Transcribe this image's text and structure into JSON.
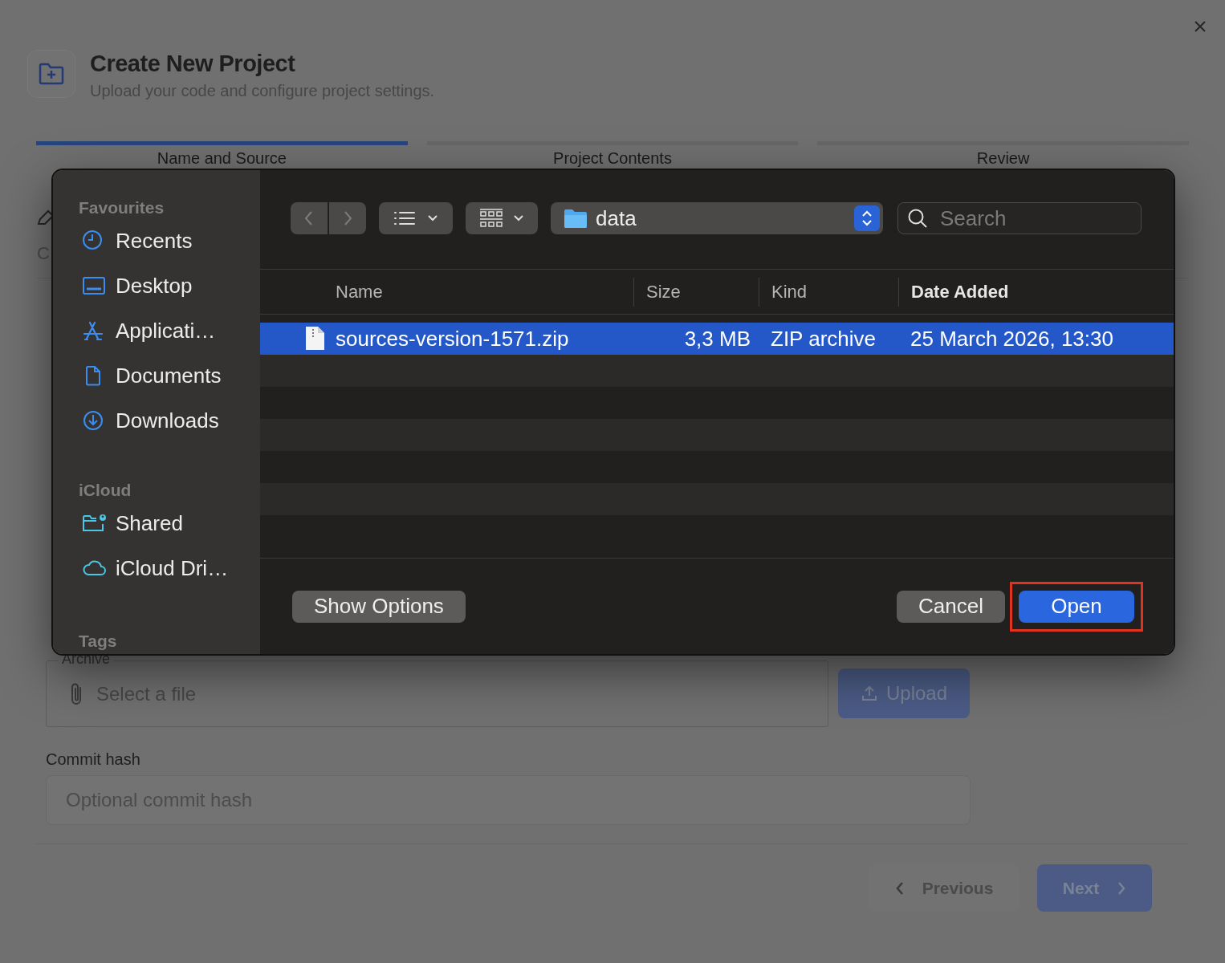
{
  "header": {
    "title": "Create New Project",
    "subtitle": "Upload your code and configure project settings."
  },
  "steps": [
    {
      "label": "Name and Source",
      "selected": true
    },
    {
      "label": "Project Contents",
      "selected": false
    },
    {
      "label": "Review",
      "selected": false
    }
  ],
  "obscured_fragment": "C",
  "archive_field": {
    "label": "Archive",
    "placeholder": "Select a file"
  },
  "upload_button": {
    "label": "Upload",
    "disabled": true
  },
  "commit_field": {
    "label": "Commit hash",
    "placeholder": "Optional commit hash"
  },
  "nav_buttons": {
    "previous": "Previous",
    "next": "Next"
  },
  "file_dialog": {
    "sidebar": [
      {
        "heading": "Favourites",
        "items": [
          {
            "label": "Recents",
            "kind": "clock"
          },
          {
            "label": "Desktop",
            "kind": "desktop"
          },
          {
            "label": "Applicati…",
            "kind": "apps"
          },
          {
            "label": "Documents",
            "kind": "document"
          },
          {
            "label": "Downloads",
            "kind": "download"
          }
        ]
      },
      {
        "heading": "iCloud",
        "items": [
          {
            "label": "Shared",
            "kind": "shared"
          },
          {
            "label": "iCloud Dri…",
            "kind": "cloud"
          }
        ]
      },
      {
        "heading": "Tags"
      }
    ],
    "location": "data",
    "search_placeholder": "Search",
    "columns": [
      {
        "label": "Name",
        "sorted": false
      },
      {
        "label": "Size",
        "sorted": false
      },
      {
        "label": "Kind",
        "sorted": false
      },
      {
        "label": "Date Added",
        "sorted": true
      }
    ],
    "rows": [
      {
        "name": "sources-version-1571.zip",
        "size": "3,3 MB",
        "kind": "ZIP archive",
        "date_added": "25 March 2026, 13:30",
        "selected": true
      }
    ],
    "buttons": [
      {
        "label": "Show Options",
        "kind": "secondary",
        "highlighted": false
      },
      {
        "label": "Cancel",
        "kind": "secondary",
        "highlighted": false
      },
      {
        "label": "Open",
        "kind": "primary",
        "highlighted": true
      }
    ]
  }
}
